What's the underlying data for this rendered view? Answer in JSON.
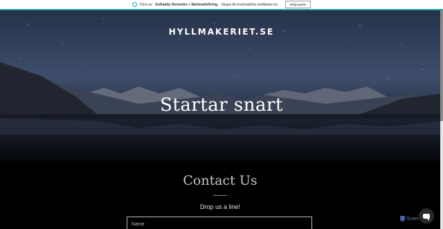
{
  "promo": {
    "prefix": "Drivs av",
    "brand": "GoDaddy Hemsidor + Marknadsföring.",
    "suffix": "Skapa din kostnadsfria webbplats nu.",
    "cta": "Börja gratis",
    "icon": "godaddy-icon",
    "accent": "#1ba5a5"
  },
  "hero": {
    "site_title": "HYLLMAKERIET.SE",
    "heading": "Startar snart"
  },
  "contact": {
    "heading": "Contact Us",
    "subheading": "Drop us a line!",
    "name_placeholder": "Name"
  },
  "chat": {
    "icon": "chat-bubble-icon"
  },
  "badge": {
    "label": "Scam",
    "icon": "shield-icon"
  }
}
